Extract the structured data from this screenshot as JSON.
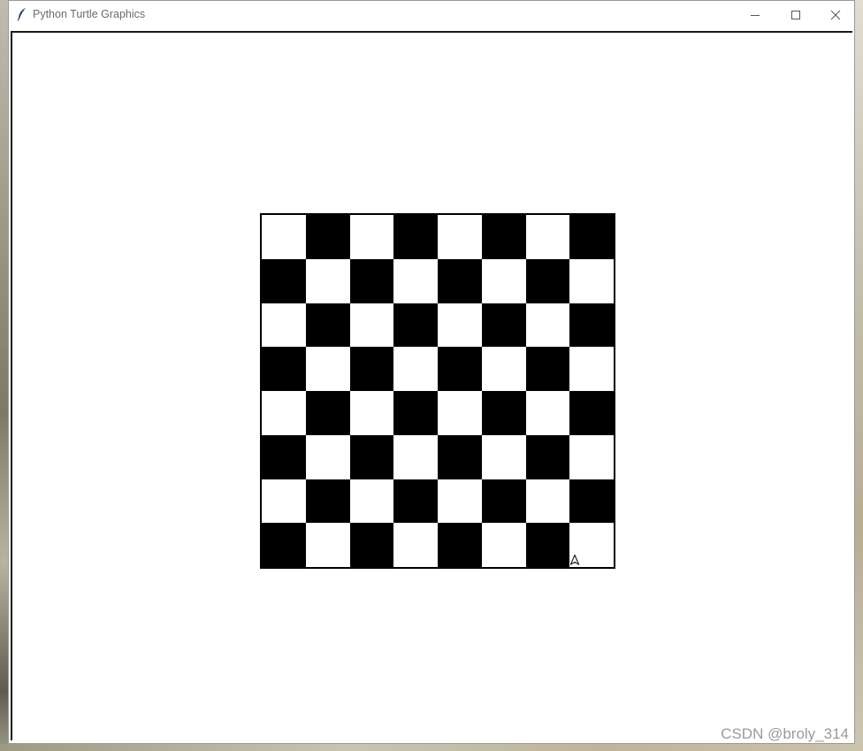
{
  "window": {
    "title": "Python Turtle Graphics",
    "app_icon": "feather-icon",
    "controls": [
      "minimize-icon",
      "maximize-icon",
      "close-icon"
    ]
  },
  "board": {
    "rows": 8,
    "cols": 8,
    "top_left_color": "white",
    "colors": {
      "dark": "#000000",
      "light": "#ffffff"
    }
  },
  "turtle": {
    "shape": "arrow",
    "icon": "turtle-arrow-icon"
  },
  "watermark": "CSDN @broly_314"
}
